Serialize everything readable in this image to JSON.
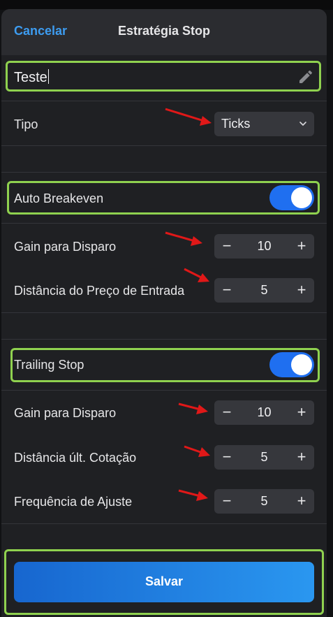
{
  "header": {
    "cancel_label": "Cancelar",
    "title": "Estratégia Stop"
  },
  "name_field": {
    "value": "Teste",
    "icon": "pencil-icon"
  },
  "tipo": {
    "label": "Tipo",
    "selected": "Ticks",
    "icon": "chevron-down-icon"
  },
  "auto_breakeven": {
    "label": "Auto Breakeven",
    "enabled": true,
    "gain": {
      "label": "Gain para Disparo",
      "value": "10"
    },
    "distance": {
      "label": "Distância do Preço de Entrada",
      "value": "5"
    }
  },
  "trailing_stop": {
    "label": "Trailing Stop",
    "enabled": true,
    "gain": {
      "label": "Gain para Disparo",
      "value": "10"
    },
    "distance": {
      "label": "Distância últ. Cotação",
      "value": "5"
    },
    "frequency": {
      "label": "Frequência de Ajuste",
      "value": "5"
    }
  },
  "stepper": {
    "minus": "−",
    "plus": "+"
  },
  "save_label": "Salvar",
  "colors": {
    "accent": "#1f6ff0",
    "highlight": "#8fd14f",
    "annotation_arrow": "#e01818",
    "link": "#3d9cf0"
  }
}
